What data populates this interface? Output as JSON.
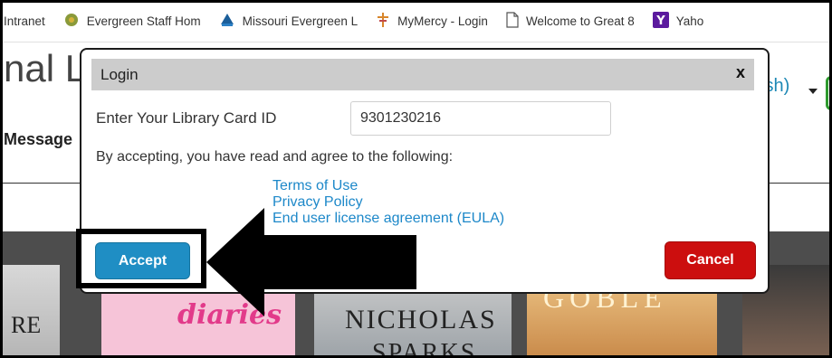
{
  "bookmarks": [
    {
      "label": "Intranet",
      "icon": "none"
    },
    {
      "label": "Evergreen Staff Hom",
      "icon": "evergreen-tree-icon"
    },
    {
      "label": "Missouri Evergreen L",
      "icon": "missouri-evergreen-icon"
    },
    {
      "label": "MyMercy - Login",
      "icon": "cross-icon"
    },
    {
      "label": "Welcome to Great 8",
      "icon": "document-icon"
    },
    {
      "label": "Yaho",
      "icon": "yahoo-icon"
    }
  ],
  "page": {
    "title_fragment": "nal L",
    "message_fragment": "Message",
    "language_fragment": "ish)"
  },
  "books": [
    {
      "text": "RE"
    },
    {
      "text": "diaries"
    },
    {
      "line1": "NICHOLAS",
      "line2": "SPARKS"
    },
    {
      "text": "GOBLE"
    },
    {
      "text": ""
    }
  ],
  "modal": {
    "title": "Login",
    "close_label": "x",
    "card_label": "Enter Your Library Card ID",
    "card_value": "9301230216",
    "agreement_text": "By accepting, you have read and agree to the following:",
    "links": [
      "Terms of Use",
      "Privacy Policy",
      "End user license agreement (EULA)"
    ],
    "accept_label": "Accept",
    "cancel_label": "Cancel"
  },
  "colors": {
    "accept": "#1f8ec4",
    "cancel": "#cc0e0e",
    "link": "#1d88c9",
    "header": "#cccccc"
  }
}
